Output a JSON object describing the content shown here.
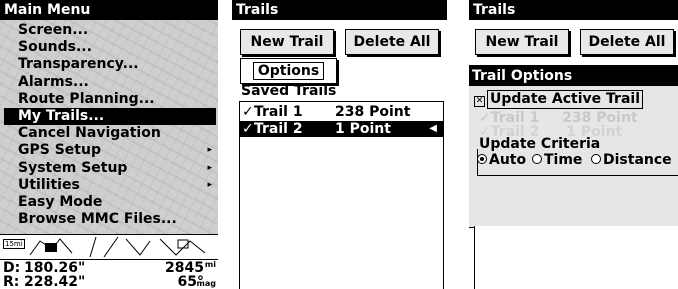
{
  "screen1": {
    "title": "Main Menu",
    "menu": [
      {
        "label": "Screen...",
        "selected": false,
        "submenu": false
      },
      {
        "label": "Sounds...",
        "selected": false,
        "submenu": false
      },
      {
        "label": "Transparency...",
        "selected": false,
        "submenu": false
      },
      {
        "label": "Alarms...",
        "selected": false,
        "submenu": false
      },
      {
        "label": "Route Planning...",
        "selected": false,
        "submenu": false
      },
      {
        "label": "My Trails...",
        "selected": true,
        "submenu": false
      },
      {
        "label": "Cancel Navigation",
        "selected": false,
        "submenu": false
      },
      {
        "label": "GPS Setup",
        "selected": false,
        "submenu": true
      },
      {
        "label": "System Setup",
        "selected": false,
        "submenu": true
      },
      {
        "label": "Utilities",
        "selected": false,
        "submenu": true
      },
      {
        "label": "Easy Mode",
        "selected": false,
        "submenu": false
      },
      {
        "label": "Browse MMC Files...",
        "selected": false,
        "submenu": false
      }
    ],
    "map_scale": "15mi",
    "readouts": {
      "distance_label": "D:",
      "distance_value": "180.26\"",
      "distance_right": "2845",
      "distance_unit": "mi",
      "bearing_label": "R:",
      "bearing_value": "228.42\"",
      "bearing_right": "65°",
      "bearing_unit": "mag"
    }
  },
  "screen2": {
    "title": "Trails",
    "new_trail_label": "New Trail",
    "delete_all_label": "Delete All",
    "options_label": "Options",
    "saved_trails_label": "Saved Trails",
    "trails": [
      {
        "check": "✓",
        "name": "Trail 1",
        "points": "238 Point",
        "selected": false
      },
      {
        "check": "✓",
        "name": "Trail 2",
        "points": "1 Point",
        "selected": true
      }
    ],
    "pointer_icon": "arrow-left-icon"
  },
  "screen3": {
    "title": "Trails",
    "new_trail_label": "New Trail",
    "delete_all_label": "Delete All",
    "options_title": "Trail Options",
    "update_active_trail_label": "Update Active Trail",
    "update_active_trail_checked": true,
    "ghost_trail_text": "✓Trail 1",
    "ghost_points_text": "238 Point",
    "ghost_trail2_text": "✓Trail 2",
    "ghost_points2_text": "1 Point",
    "update_criteria_label": "Update Criteria",
    "criteria_options": [
      {
        "label": "Auto",
        "selected": true
      },
      {
        "label": "Time",
        "selected": false
      },
      {
        "label": "Distance",
        "selected": false
      }
    ]
  }
}
